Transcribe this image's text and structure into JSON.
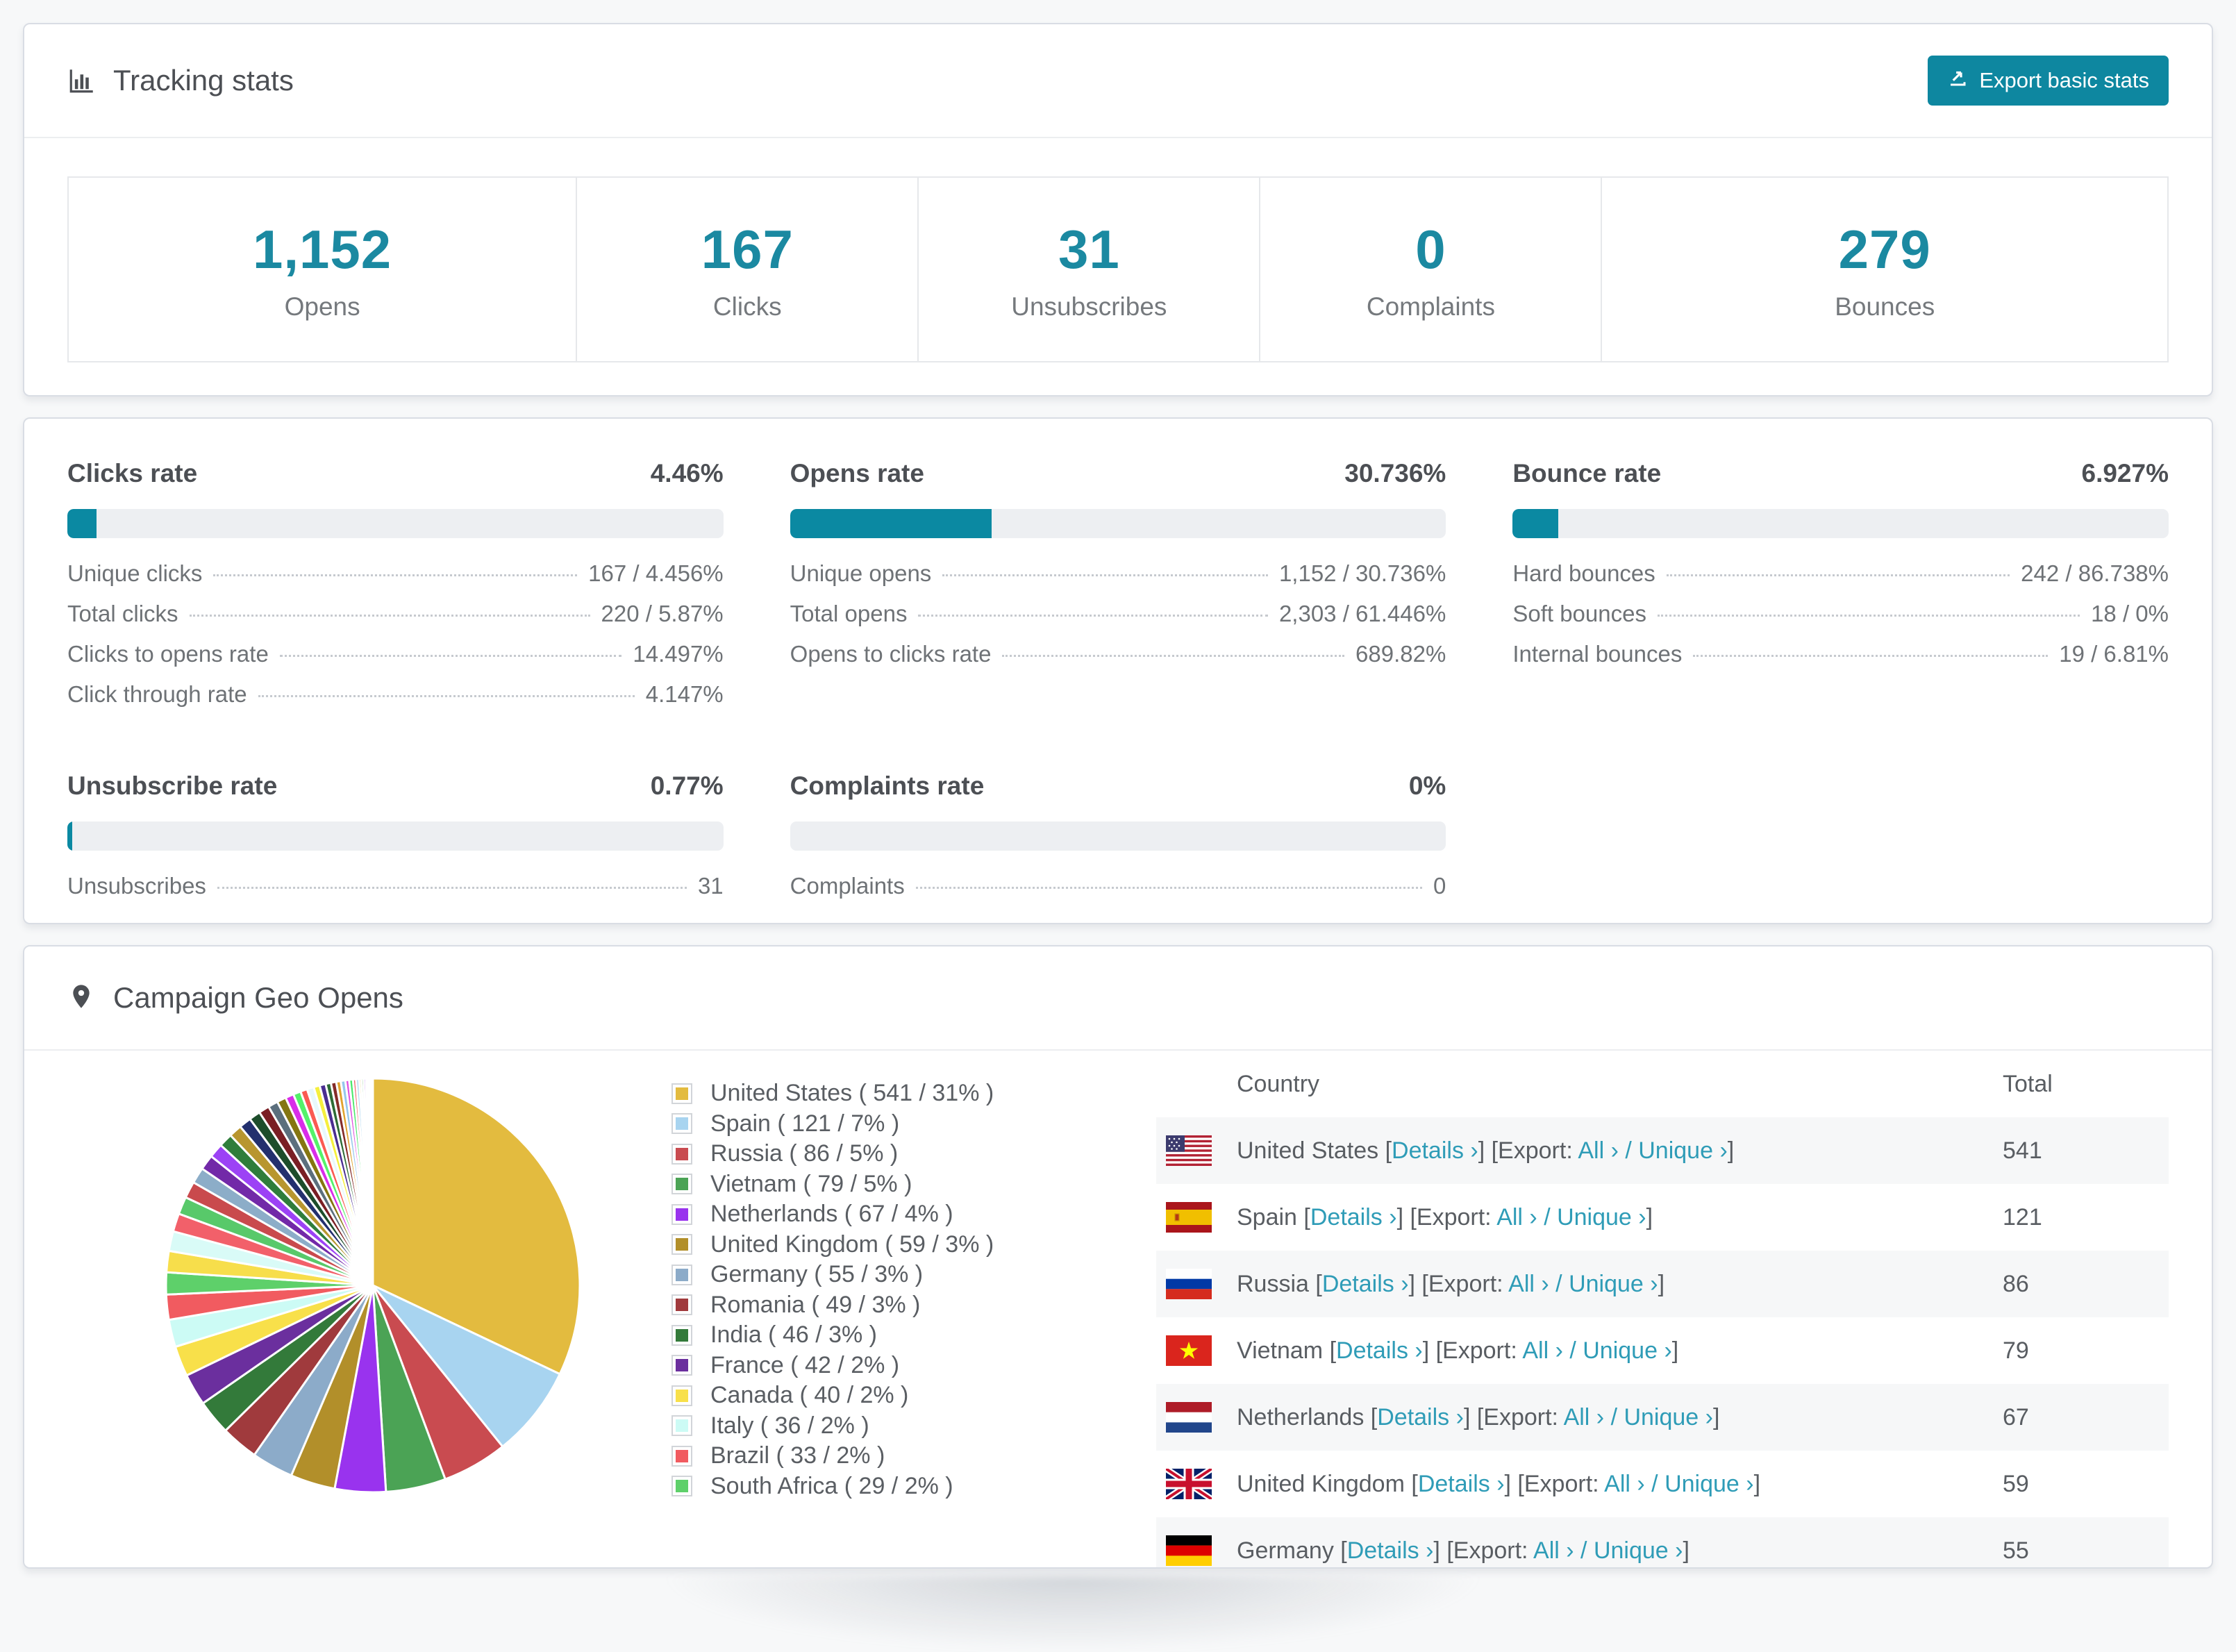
{
  "tracking": {
    "title": "Tracking stats",
    "export_button": "Export basic stats",
    "summary": [
      {
        "value": "1,152",
        "label": "Opens",
        "flex": 1.49
      },
      {
        "value": "167",
        "label": "Clicks",
        "flex": 1.0
      },
      {
        "value": "31",
        "label": "Unsubscribes",
        "flex": 1.0
      },
      {
        "value": "0",
        "label": "Complaints",
        "flex": 1.0
      },
      {
        "value": "279",
        "label": "Bounces",
        "flex": 1.66
      }
    ]
  },
  "rates": [
    {
      "title": "Clicks rate",
      "value": "4.46%",
      "percent": 4.46,
      "rows": [
        {
          "label": "Unique clicks",
          "value": "167 / 4.456%"
        },
        {
          "label": "Total clicks",
          "value": "220 / 5.87%"
        },
        {
          "label": "Clicks to opens rate",
          "value": "14.497%"
        },
        {
          "label": "Click through rate",
          "value": "4.147%"
        }
      ]
    },
    {
      "title": "Opens rate",
      "value": "30.736%",
      "percent": 30.736,
      "rows": [
        {
          "label": "Unique opens",
          "value": "1,152 / 30.736%"
        },
        {
          "label": "Total opens",
          "value": "2,303 / 61.446%"
        },
        {
          "label": "Opens to clicks rate",
          "value": "689.82%"
        }
      ]
    },
    {
      "title": "Bounce rate",
      "value": "6.927%",
      "percent": 6.927,
      "rows": [
        {
          "label": "Hard bounces",
          "value": "242 / 86.738%"
        },
        {
          "label": "Soft bounces",
          "value": "18 / 0%"
        },
        {
          "label": "Internal bounces",
          "value": "19 / 6.81%"
        }
      ]
    },
    {
      "title": "Unsubscribe rate",
      "value": "0.77%",
      "percent": 0.77,
      "rows": [
        {
          "label": "Unsubscribes",
          "value": "31"
        }
      ]
    },
    {
      "title": "Complaints rate",
      "value": "0%",
      "percent": 0,
      "rows": [
        {
          "label": "Complaints",
          "value": "0"
        }
      ]
    }
  ],
  "geo": {
    "title": "Campaign Geo Opens",
    "legend": [
      {
        "label": "United States ( 541 / 31% )",
        "color": "#e3bb3f"
      },
      {
        "label": "Spain ( 121 / 7% )",
        "color": "#a8d4f0"
      },
      {
        "label": "Russia ( 86 / 5% )",
        "color": "#c94b50"
      },
      {
        "label": "Vietnam ( 79 / 5% )",
        "color": "#4ba355"
      },
      {
        "label": "Netherlands ( 67 / 4% )",
        "color": "#9933ee"
      },
      {
        "label": "United Kingdom ( 59 / 3% )",
        "color": "#b28f2a"
      },
      {
        "label": "Germany ( 55 / 3% )",
        "color": "#8cabc9"
      },
      {
        "label": "Romania ( 49 / 3% )",
        "color": "#a03a3d"
      },
      {
        "label": "India ( 46 / 3% )",
        "color": "#337a3a"
      },
      {
        "label": "France ( 42 / 2% )",
        "color": "#6b2f9e"
      },
      {
        "label": "Canada ( 40 / 2% )",
        "color": "#f8e04a"
      },
      {
        "label": "Italy ( 36 / 2% )",
        "color": "#ccfbf5"
      },
      {
        "label": "Brazil ( 33 / 2% )",
        "color": "#f15b60"
      },
      {
        "label": "South Africa ( 29 / 2% )",
        "color": "#5ed06a"
      }
    ],
    "table": {
      "col_country": "Country",
      "col_total": "Total",
      "labels": {
        "lb": "[",
        "rb": "]",
        "details": "Details ›",
        "export_prefix": "Export: ",
        "all": "All ›",
        "slash": " / ",
        "unique": "Unique ›"
      },
      "rows": [
        {
          "country": "United States",
          "flag": "us",
          "total": "541"
        },
        {
          "country": "Spain",
          "flag": "es",
          "total": "121"
        },
        {
          "country": "Russia",
          "flag": "ru",
          "total": "86"
        },
        {
          "country": "Vietnam",
          "flag": "vn",
          "total": "79"
        },
        {
          "country": "Netherlands",
          "flag": "nl",
          "total": "67"
        },
        {
          "country": "United Kingdom",
          "flag": "gb",
          "total": "59"
        },
        {
          "country": "Germany",
          "flag": "de",
          "total": "55"
        }
      ]
    }
  },
  "chart_data": {
    "type": "pie",
    "title": "Campaign Geo Opens",
    "legend_position": "right",
    "start_angle_deg": -90,
    "direction": "clockwise",
    "slices": [
      {
        "label": "United States",
        "value": 541,
        "pct": "31%",
        "color": "#e3bb3f"
      },
      {
        "label": "Spain",
        "value": 121,
        "pct": "7%",
        "color": "#a8d4f0"
      },
      {
        "label": "Russia",
        "value": 86,
        "pct": "5%",
        "color": "#c94b50"
      },
      {
        "label": "Vietnam",
        "value": 79,
        "pct": "5%",
        "color": "#4ba355"
      },
      {
        "label": "Netherlands",
        "value": 67,
        "pct": "4%",
        "color": "#9933ee"
      },
      {
        "label": "United Kingdom",
        "value": 59,
        "pct": "3%",
        "color": "#b28f2a"
      },
      {
        "label": "Germany",
        "value": 55,
        "pct": "3%",
        "color": "#8cabc9"
      },
      {
        "label": "Romania",
        "value": 49,
        "pct": "3%",
        "color": "#a03a3d"
      },
      {
        "label": "India",
        "value": 46,
        "pct": "3%",
        "color": "#337a3a"
      },
      {
        "label": "France",
        "value": 42,
        "pct": "2%",
        "color": "#6b2f9e"
      },
      {
        "label": "Canada",
        "value": 40,
        "pct": "2%",
        "color": "#f8e04a"
      },
      {
        "label": "Italy",
        "value": 36,
        "pct": "2%",
        "color": "#ccfbf5"
      },
      {
        "label": "Brazil",
        "value": 33,
        "pct": "2%",
        "color": "#f15b60"
      },
      {
        "label": "South Africa",
        "value": 29,
        "pct": "2%",
        "color": "#5ed06a"
      }
    ],
    "small_slices": [
      {
        "value": 28,
        "color": "#f7de4b"
      },
      {
        "value": 26,
        "color": "#d9fbf7"
      },
      {
        "value": 24,
        "color": "#f2606a"
      },
      {
        "value": 23,
        "color": "#58c96a"
      },
      {
        "value": 22,
        "color": "#c94a4d"
      },
      {
        "value": 21,
        "color": "#8cadc8"
      },
      {
        "value": 20,
        "color": "#7229a8"
      },
      {
        "value": 19,
        "color": "#9c42f5"
      },
      {
        "value": 18,
        "color": "#2f7d3b"
      },
      {
        "value": 17,
        "color": "#b8962f"
      },
      {
        "value": 16,
        "color": "#23306e"
      },
      {
        "value": 15,
        "color": "#1d4d2b"
      },
      {
        "value": 14,
        "color": "#7a1f24"
      },
      {
        "value": 13,
        "color": "#5c6f7d"
      },
      {
        "value": 12,
        "color": "#857611"
      },
      {
        "value": 11,
        "color": "#d92de9"
      },
      {
        "value": 10,
        "color": "#54f26a"
      },
      {
        "value": 9,
        "color": "#fa5a52"
      },
      {
        "value": 9,
        "color": "#e8f8fb"
      },
      {
        "value": 8,
        "color": "#f5ef3d"
      },
      {
        "value": 8,
        "color": "#4a2d91"
      },
      {
        "value": 7,
        "color": "#2d6b35"
      },
      {
        "value": 7,
        "color": "#852c28"
      },
      {
        "value": 6,
        "color": "#e0a32e"
      },
      {
        "value": 6,
        "color": "#96c7ec"
      },
      {
        "value": 5,
        "color": "#e04fe0"
      },
      {
        "value": 5,
        "color": "#49e86a"
      },
      {
        "value": 4,
        "color": "#f2606a"
      },
      {
        "value": 4,
        "color": "#a8d4f0"
      },
      {
        "value": 3,
        "color": "#e3bb3f"
      },
      {
        "value": 3,
        "color": "#4ba355"
      },
      {
        "value": 3,
        "color": "#9933ee"
      },
      {
        "value": 2,
        "color": "#c94b50"
      },
      {
        "value": 2,
        "color": "#337a3a"
      },
      {
        "value": 2,
        "color": "#f8e04a"
      },
      {
        "value": 1,
        "color": "#6b2f9e"
      },
      {
        "value": 1,
        "color": "#f15b60"
      },
      {
        "value": 1,
        "color": "#8cabc9"
      }
    ]
  }
}
